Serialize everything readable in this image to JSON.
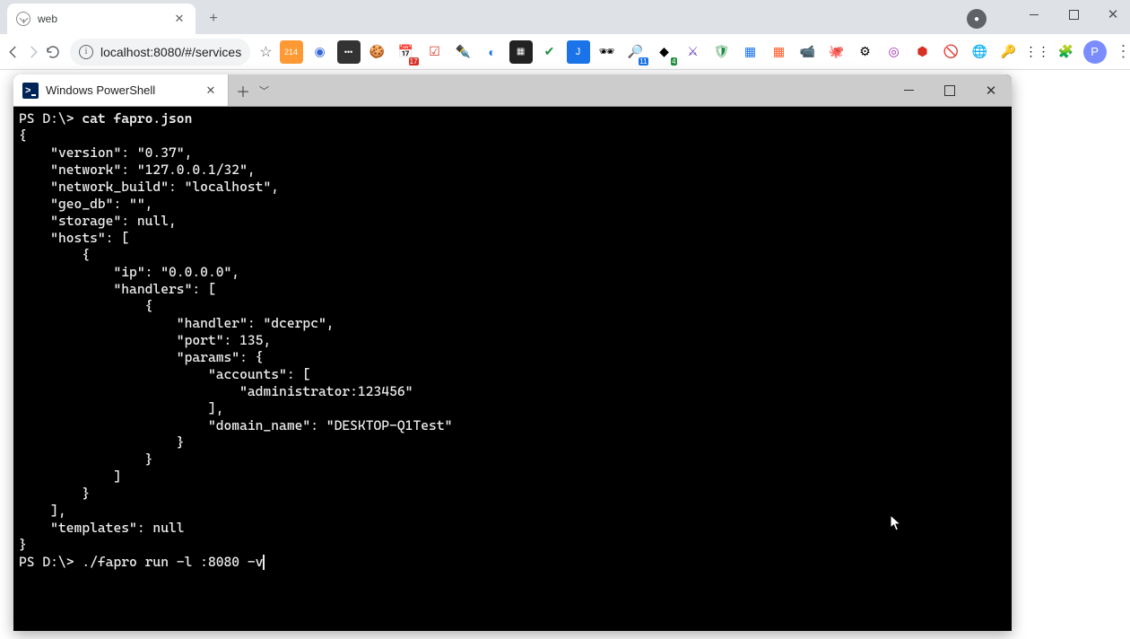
{
  "chrome": {
    "tab_title": "web",
    "address": "localhost:8080/#/services",
    "window_controls": {
      "min": "–",
      "max": "□",
      "close": "✕"
    },
    "newtab_label": "+",
    "account_initial": "P",
    "ext_badges": [
      "214",
      "17",
      "11",
      "4"
    ],
    "menu_glyph": "⋮"
  },
  "terminal": {
    "tab_title": "Windows PowerShell",
    "window_controls": {
      "min": "–",
      "max": "□",
      "close": "✕"
    },
    "prompt1": "PS D:\\> ",
    "cmd1": "cat fapro.json",
    "json_body": "{\n    \"version\": \"0.37\",\n    \"network\": \"127.0.0.1/32\",\n    \"network_build\": \"localhost\",\n    \"geo_db\": \"\",\n    \"storage\": null,\n    \"hosts\": [\n        {\n            \"ip\": \"0.0.0.0\",\n            \"handlers\": [\n                {\n                    \"handler\": \"dcerpc\",\n                    \"port\": 135,\n                    \"params\": {\n                        \"accounts\": [\n                            \"administrator:123456\"\n                        ],\n                        \"domain_name\": \"DESKTOP-Q1Test\"\n                    }\n                }\n            ]\n        }\n    ],\n    \"templates\": null\n}",
    "prompt2": "PS D:\\> ",
    "cmd2": "./fapro run -l :8080 -v"
  }
}
